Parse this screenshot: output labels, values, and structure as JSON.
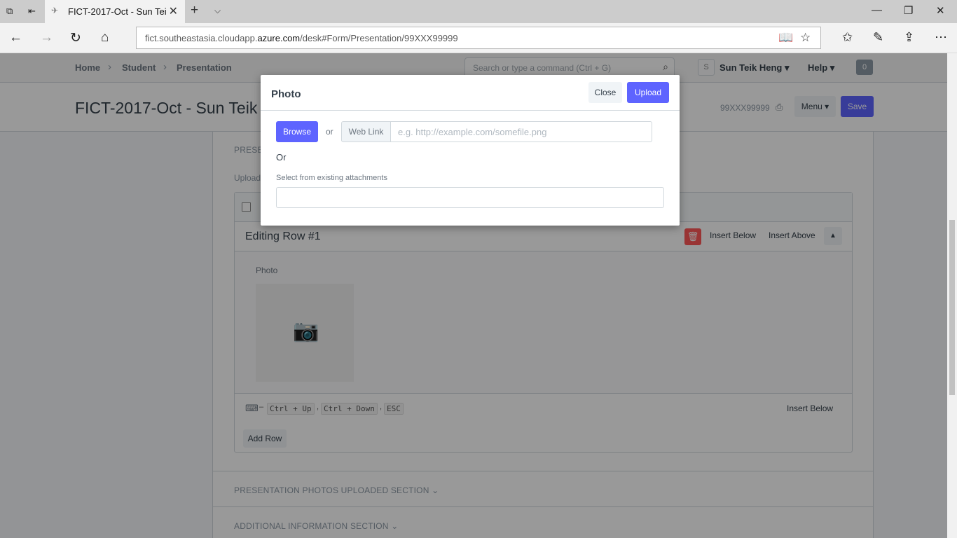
{
  "browser": {
    "tab_title": "FICT-2017-Oct - Sun Tei",
    "url_prefix": "fict.southeastasia.cloudapp.",
    "url_host": "azure.com",
    "url_path": "/desk#Form/Presentation/99XXX99999"
  },
  "navbar": {
    "breadcrumbs": [
      "Home",
      "Student",
      "Presentation"
    ],
    "search_placeholder": "Search or type a command (Ctrl + G)",
    "avatar_letter": "S",
    "user_name": "Sun Teik Heng",
    "help_label": "Help",
    "notification_count": "0"
  },
  "page": {
    "title": "FICT-2017-Oct - Sun Teik",
    "doc_name": "99XXX99999",
    "menu_label": "Menu",
    "save_label": "Save"
  },
  "form": {
    "section_top": "PRESEN",
    "upload_label": "Upload",
    "editing_title": "Editing Row #1",
    "insert_below": "Insert Below",
    "insert_above": "Insert Above",
    "photo_label": "Photo",
    "shortcuts": [
      "Ctrl + Up",
      "Ctrl + Down",
      "ESC"
    ],
    "shortcut_dash": "–",
    "footer_insert_below": "Insert Below",
    "add_row": "Add Row",
    "section_uploaded": "PRESENTATION PHOTOS UPLOADED SECTION",
    "section_additional": "ADDITIONAL INFORMATION SECTION"
  },
  "modal": {
    "title": "Photo",
    "close_label": "Close",
    "upload_label": "Upload",
    "browse_label": "Browse",
    "or_small": "or",
    "web_link_label": "Web Link",
    "web_link_placeholder": "e.g. http://example.com/somefile.png",
    "or_large": "Or",
    "select_label": "Select from existing attachments",
    "select_value": ""
  },
  "colors": {
    "primary": "#5e64ff",
    "danger": "#ff5858",
    "text": "#36414c",
    "muted": "#8d99a6"
  }
}
